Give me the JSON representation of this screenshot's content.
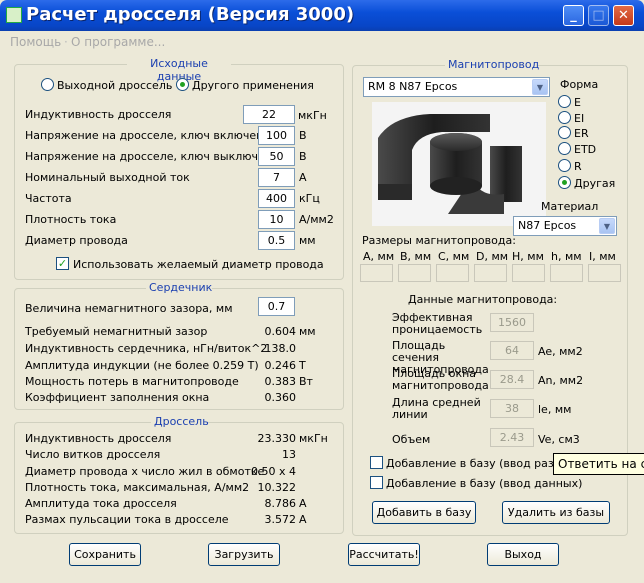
{
  "window": {
    "title": "Расчет дросселя (Версия 3000)",
    "min": "_",
    "max": "□",
    "close": "✕"
  },
  "menu": [
    "Помощь",
    "О программе..."
  ],
  "initial": {
    "legend": "Исходные данные",
    "radio_output": "Выходной дроссель",
    "radio_other": "Другого применения",
    "rows": [
      {
        "label": "Индуктивность  дросселя",
        "value": "22",
        "unit": "мкГн"
      },
      {
        "label": "Напряжение на дросселе, ключ включен",
        "value": "100",
        "unit": "В"
      },
      {
        "label": "Напряжение на дросселе, ключ выключен",
        "value": "50",
        "unit": "В"
      },
      {
        "label": "Номинальный выходной ток",
        "value": "7",
        "unit": "А"
      },
      {
        "label": "Частота",
        "value": "400",
        "unit": "кГц"
      },
      {
        "label": "Плотность тока",
        "value": "10",
        "unit": "А/мм2"
      },
      {
        "label": "Диаметр провода",
        "value": "0.5",
        "unit": "мм"
      }
    ],
    "use_wire_label": "Использовать желаемый диаметр провода"
  },
  "core": {
    "legend": "Сердечник",
    "gap_label": "Величина немагнитного зазора, мм",
    "gap_value": "0.7",
    "rows": [
      {
        "label": "Требуемый немагнитный зазор",
        "value": "0.604",
        "unit": "мм"
      },
      {
        "label": "Индуктивность сердечника, нГн/виток^2",
        "value": "138.0",
        "unit": ""
      },
      {
        "label": "Амплитуда индукции    (не более 0.259 Т)",
        "value": "0.246",
        "unit": "Т"
      },
      {
        "label": "Мощность потерь в магнитопроводе",
        "value": "0.383",
        "unit": "Вт"
      },
      {
        "label": "Коэффициент заполнения окна",
        "value": "0.360",
        "unit": ""
      }
    ]
  },
  "choke": {
    "legend": "Дроссель",
    "rows": [
      {
        "label": "Индуктивность дросселя",
        "value": "23.330",
        "unit": "мкГн"
      },
      {
        "label": "Число витков дросселя",
        "value": "13",
        "unit": ""
      },
      {
        "label": "Диаметр провода x число жил в обмотке",
        "value": "0.50 x 4",
        "unit": ""
      },
      {
        "label": "Плотность тока, максимальная, А/мм2",
        "value": "10.322",
        "unit": ""
      },
      {
        "label": "Амплитуда тока дросселя",
        "value": "8.786",
        "unit": "А"
      },
      {
        "label": "Размах пульсации тока в дросселе",
        "value": "3.572",
        "unit": "А"
      }
    ]
  },
  "magnet": {
    "legend": "Магнитопровод",
    "combo": "RM 8 N87 Epcos",
    "form_label": "Форма",
    "forms": [
      "E",
      "EI",
      "ER",
      "ETD",
      "R",
      "Другая"
    ],
    "material_label": "Материал",
    "material": "N87 Epcos",
    "dims_label": "Размеры магнитопровода:",
    "dims": [
      "A, мм",
      "B, мм",
      "C, мм",
      "D, мм",
      "H, мм",
      "h, мм",
      "I, мм"
    ],
    "data_label": "Данные магнитопровода:",
    "data": [
      {
        "label": "Эффективная проницаемость",
        "value": "1560",
        "unit": ""
      },
      {
        "label": "Площадь сечения магнитопровода",
        "value": "64",
        "unit": "Ae, мм2"
      },
      {
        "label": "Площадь окна магнитопровода",
        "value": "28.4",
        "unit": "An, мм2"
      },
      {
        "label": "Длина средней линии",
        "value": "38",
        "unit": "le, мм"
      },
      {
        "label": "Объем",
        "value": "2.43",
        "unit": "Ve, см3"
      }
    ],
    "chk1": "Добавление в базу (ввод размеров)",
    "chk2": "Добавление в базу (ввод данных)",
    "btn_add": "Добавить в базу",
    "btn_del": "Удалить из базы"
  },
  "tooltip": "Ответить на со",
  "buttons": {
    "save": "Сохранить",
    "load": "Загрузить",
    "calc": "Рассчитать!",
    "exit": "Выход"
  }
}
